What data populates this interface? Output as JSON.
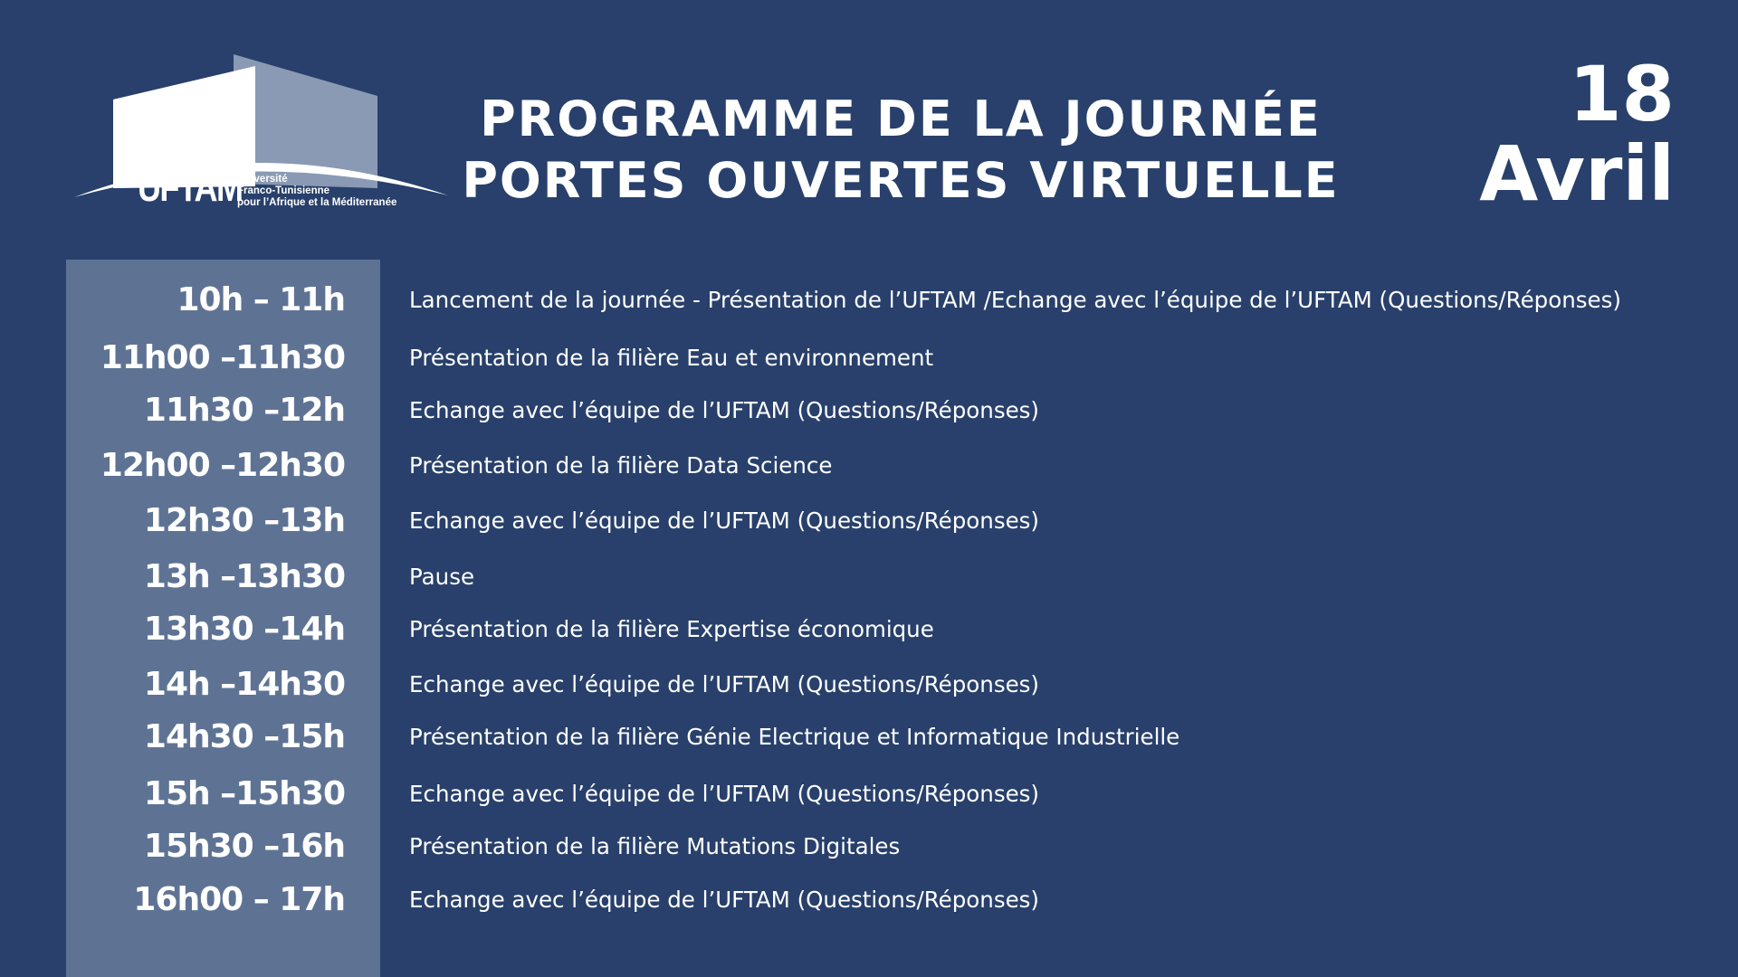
{
  "logo": {
    "word": "UFTAM",
    "sub_lines": [
      "Université",
      "Franco-Tunisienne",
      "pour l’Afrique et la Méditerranée"
    ]
  },
  "header": {
    "title_line1": "PROGRAMME DE LA JOURNÉE",
    "title_line2": "PORTES OUVERTES  VIRTUELLE",
    "date_day": "18",
    "date_month": "Avril"
  },
  "schedule": [
    {
      "time": "10h – 11h",
      "activity": "Lancement de la journée - Présentation de l’UFTAM /Echange avec l’équipe de l’UFTAM (Questions/Réponses)"
    },
    {
      "time": "11h00 –11h30",
      "activity": "Présentation de la filière Eau et environnement"
    },
    {
      "time": "11h30 –12h",
      "activity": "Echange avec l’équipe de l’UFTAM (Questions/Réponses)"
    },
    {
      "time": "12h00 –12h30",
      "activity": "Présentation de la filière Data Science"
    },
    {
      "time": "12h30 –13h",
      "activity": "Echange avec l’équipe de l’UFTAM (Questions/Réponses)"
    },
    {
      "time": "13h –13h30",
      "activity": "Pause"
    },
    {
      "time": "13h30 –14h",
      "activity": "Présentation de la filière Expertise économique"
    },
    {
      "time": "14h –14h30",
      "activity": "Echange avec l’équipe de l’UFTAM (Questions/Réponses)"
    },
    {
      "time": "14h30 –15h",
      "activity": "Présentation de la filière Génie Electrique et Informatique Industrielle"
    },
    {
      "time": "15h –15h30",
      "activity": "Echange avec l’équipe de l’UFTAM (Questions/Réponses)"
    },
    {
      "time": "15h30 –16h",
      "activity": "Présentation de la filière Mutations Digitales"
    },
    {
      "time": "16h00 – 17h",
      "activity": "Echange avec l’équipe de l’UFTAM (Questions/Réponses)"
    }
  ],
  "colors": {
    "background": "#28406b",
    "time_column": "#5e7394",
    "text": "#ffffff",
    "logo_shade": "#8a9ab4"
  }
}
